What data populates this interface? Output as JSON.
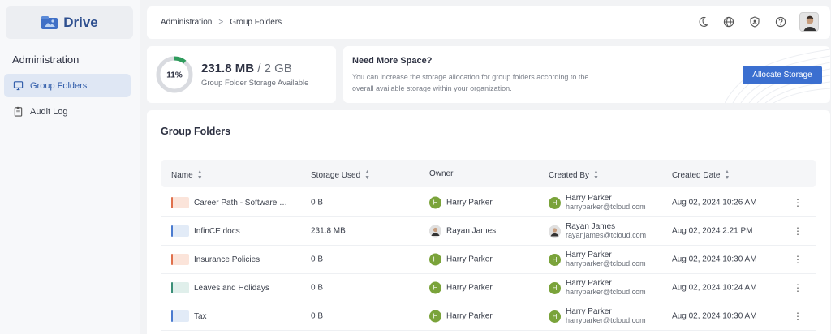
{
  "app": {
    "name": "Drive"
  },
  "sidebar": {
    "heading": "Administration",
    "items": [
      {
        "label": "Group Folders",
        "active": true
      },
      {
        "label": "Audit Log",
        "active": false
      }
    ]
  },
  "breadcrumb": {
    "root": "Administration",
    "separator": ">",
    "current": "Group Folders"
  },
  "storage": {
    "percent_label": "11%",
    "percent": 11,
    "used": "231.8 MB",
    "separator": "/",
    "total": "2 GB",
    "subtitle": "Group Folder Storage Available"
  },
  "info": {
    "title": "Need More Space?",
    "text": "You can increase the storage allocation for group folders according to the overall available storage within your organization.",
    "button": "Allocate Storage"
  },
  "main": {
    "title": "Group Folders",
    "columns": [
      "Name",
      "Storage Used",
      "Owner",
      "Created By",
      "Created Date"
    ],
    "rows": [
      {
        "name": "Career Path - Software E...",
        "storage": "0 B",
        "owner": "Harry Parker",
        "creator_name": "Harry Parker",
        "creator_email": "harryparker@tcloud.com",
        "date": "Aug 02, 2024 10:26 AM"
      },
      {
        "name": "InfinCE docs",
        "storage": "231.8 MB",
        "owner": "Rayan James",
        "creator_name": "Rayan James",
        "creator_email": "rayanjames@tcloud.com",
        "date": "Aug 02, 2024 2:21 PM"
      },
      {
        "name": "Insurance Policies",
        "storage": "0 B",
        "owner": "Harry Parker",
        "creator_name": "Harry Parker",
        "creator_email": "harryparker@tcloud.com",
        "date": "Aug 02, 2024 10:30 AM"
      },
      {
        "name": "Leaves and Holidays",
        "storage": "0 B",
        "owner": "Harry Parker",
        "creator_name": "Harry Parker",
        "creator_email": "harryparker@tcloud.com",
        "date": "Aug 02, 2024 10:24 AM"
      },
      {
        "name": "Tax",
        "storage": "0 B",
        "owner": "Harry Parker",
        "creator_name": "Harry Parker",
        "creator_email": "harryparker@tcloud.com",
        "date": "Aug 02, 2024 10:30 AM"
      }
    ],
    "avatar_initial": "H",
    "row_menu_glyph": "⋮"
  },
  "colors": {
    "accent": "#3b6fd0",
    "ring": "#2e9b5c",
    "avatar": "#7aa33a"
  }
}
